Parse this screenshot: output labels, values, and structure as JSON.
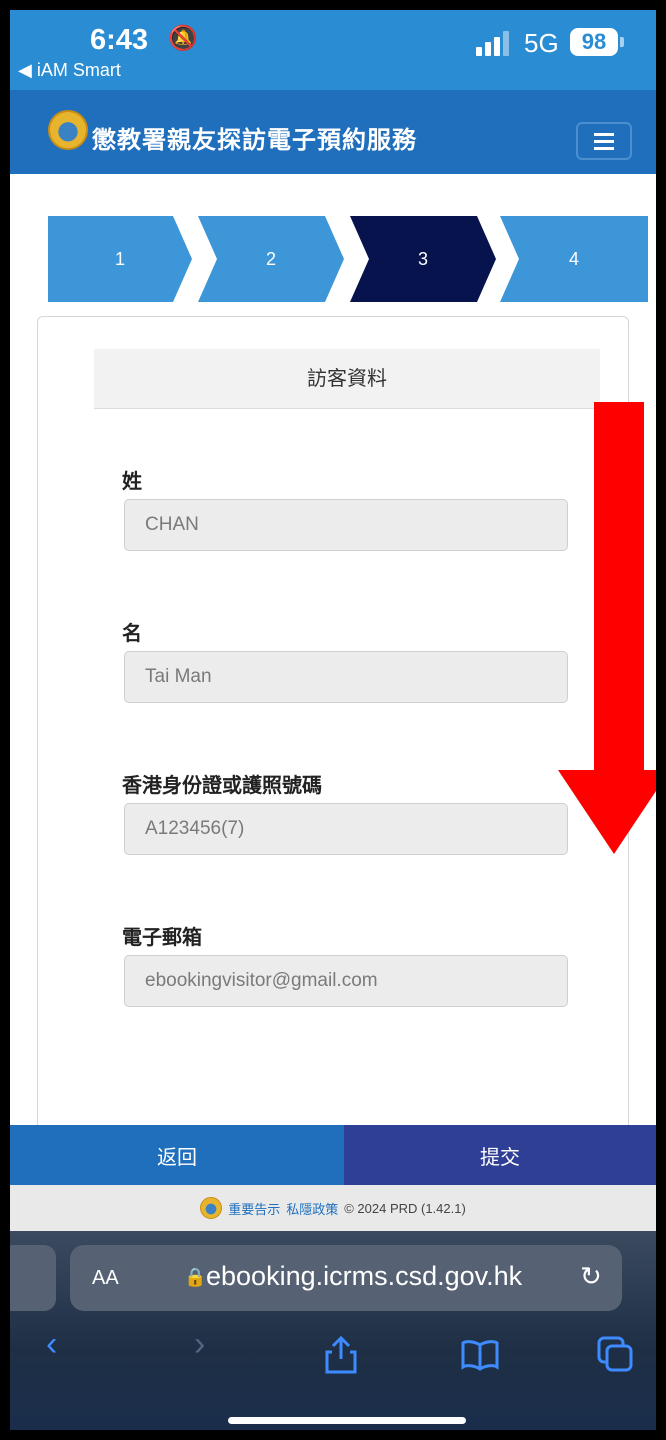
{
  "status_bar": {
    "time": "6:43",
    "back_app": "◀ iAM Smart",
    "network": "5G",
    "battery": "98"
  },
  "app_header": {
    "title": "懲教署親友探訪電子預約服務"
  },
  "stepper": {
    "steps": [
      "1",
      "2",
      "3",
      "4"
    ],
    "active_step": 3
  },
  "form": {
    "section_title": "訪客資料",
    "fields": [
      {
        "label": "姓",
        "value": "CHAN"
      },
      {
        "label": "名",
        "value": "Tai Man"
      },
      {
        "label": "香港身份證或護照號碼",
        "value": "A123456(7)"
      },
      {
        "label": "電子郵箱",
        "value": "ebookingvisitor@gmail.com"
      }
    ]
  },
  "actions": {
    "back_label": "返回",
    "submit_label": "提交"
  },
  "footer": {
    "notice_link": "重要告示",
    "privacy_link": "私隱政策",
    "copyright": "© 2024 PRD (1.42.1)"
  },
  "browser": {
    "aa_label": "AA",
    "url": "ebooking.icrms.csd.gov.hk"
  },
  "colors": {
    "status_bar": "#2a8cd2",
    "header": "#1f6fbd",
    "step_inactive": "#3d96d7",
    "step_active": "#07134d",
    "submit": "#2e3f95",
    "arrow": "#ff0000"
  }
}
